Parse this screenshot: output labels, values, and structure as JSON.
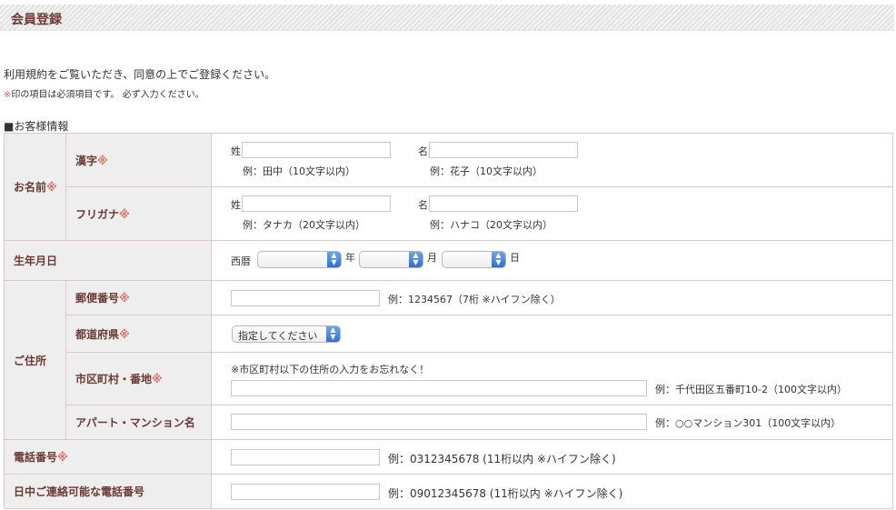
{
  "header": {
    "title": "会員登録"
  },
  "intro": {
    "text": "利用規約をご覧いただき、同意の上でご登録ください。"
  },
  "required_note": {
    "mark": "※",
    "text": "印の項目は必須項目です。 必ず入力ください。"
  },
  "section": {
    "label": "■お客様情報"
  },
  "required_mark": "※",
  "name": {
    "label": "お名前",
    "kanji": {
      "label": "漢字",
      "last_label": "姓",
      "first_label": "名",
      "last_example": "例：田中（10文字以内）",
      "first_example": "例：花子（10文字以内）"
    },
    "furigana": {
      "label": "フリガナ",
      "last_label": "姓",
      "first_label": "名",
      "last_example": "例：タナカ（20文字以内）",
      "first_example": "例：ハナコ（20文字以内）"
    }
  },
  "birthday": {
    "label": "生年月日",
    "era": "西暦",
    "year": "年",
    "month": "月",
    "day": "日"
  },
  "address": {
    "label": "ご住所",
    "postal": {
      "label": "郵便番号",
      "example": "例：1234567（7桁 ※ハイフン除く）"
    },
    "prefecture": {
      "label": "都道府県",
      "selected": "指定してください"
    },
    "city": {
      "label": "市区町村・番地",
      "note": "※市区町村以下の住所の入力をお忘れなく！",
      "example": "例：千代田区五番町10-2（100文字以内）"
    },
    "apartment": {
      "label": "アパート・マンション名",
      "example": "例：○○マンション301（100文字以内）"
    }
  },
  "phone": {
    "label": "電話番号",
    "example": "例：0312345678 (11桁以内 ※ハイフン除く)"
  },
  "day_phone": {
    "label": "日中ご連絡可能な電話番号",
    "example": "例：09012345678 (11桁以内 ※ハイフン除く)"
  }
}
